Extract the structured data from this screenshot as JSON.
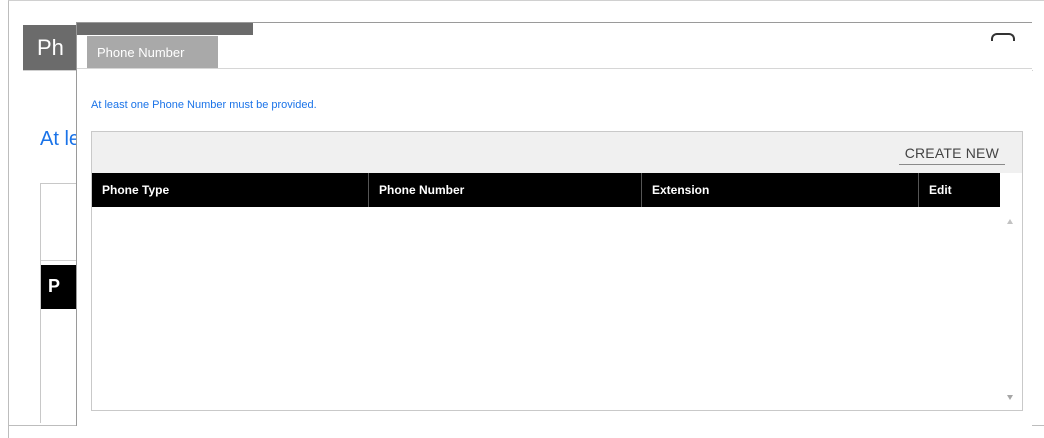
{
  "background_page": {
    "title_partial": "Ph",
    "notice_partial": "At le",
    "table_header_partial": "P"
  },
  "modal": {
    "tab_label": "Phone Number",
    "notice": "At least one Phone Number must be provided.",
    "toolbar": {
      "create_new_label": "CREATE NEW"
    },
    "grid": {
      "columns": [
        "Phone Type",
        "Phone Number",
        "Extension",
        "Edit"
      ],
      "rows": []
    }
  },
  "colors": {
    "header_dark": "#6b6b6b",
    "tab_gray": "#a9a9a9",
    "notice_blue": "#1a73e8",
    "grid_header_bg": "#000000",
    "toolbar_bg": "#f0f0f0"
  },
  "icons": [
    "close-icon",
    "scroll-up-arrow-icon",
    "scroll-down-arrow-icon"
  ]
}
